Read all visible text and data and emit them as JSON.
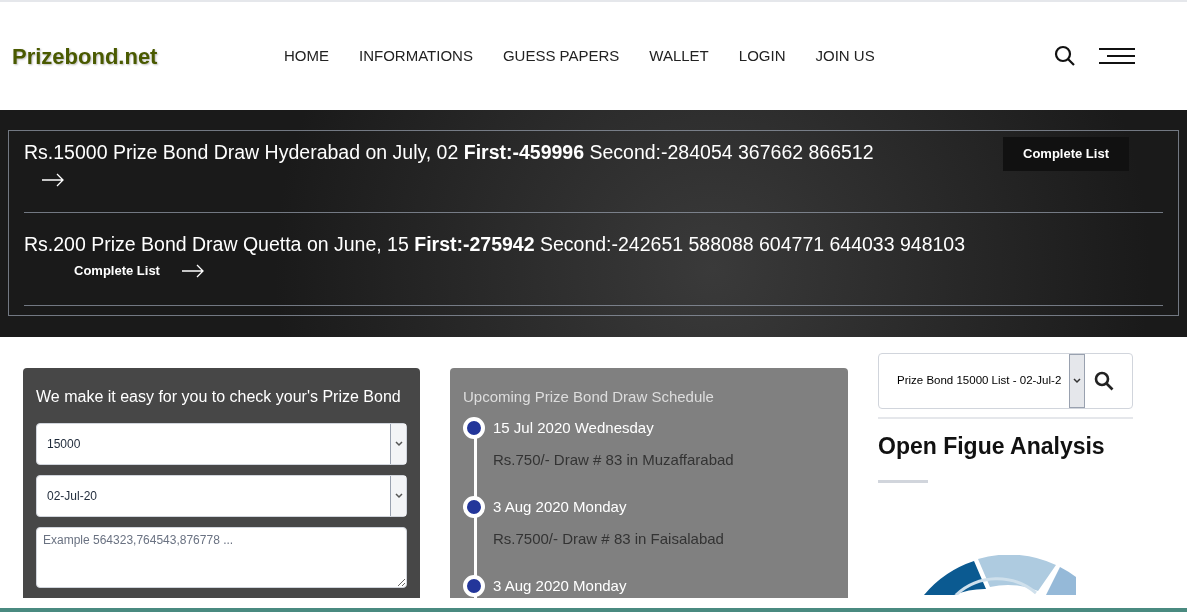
{
  "header": {
    "logo": "Prizebond.net",
    "nav": [
      "HOME",
      "INFORMATIONS",
      "GUESS PAPERS",
      "WALLET",
      "LOGIN",
      "JOIN US"
    ]
  },
  "banner": {
    "draws": [
      {
        "kind": "button_right",
        "text": "Rs.15000 Prize Bond Draw Hyderabad on July, 02 **First:-459996** Second:-284054 367662 866512",
        "button": "Complete List"
      },
      {
        "kind": "button_below",
        "text": "Rs.200 Prize Bond Draw Quetta on June, 15 **First:-275942** Second:-242651 588088 604771 644033 948103",
        "button": "Complete List"
      }
    ]
  },
  "checker": {
    "title": "We make it easy for you to check your's Prize Bond",
    "bond_select": "15000",
    "date_select": "02-Jul-20",
    "numbers_field": {
      "placeholder": "Example 564323,764543,876778 ..."
    }
  },
  "schedule": {
    "title": "Upcoming Prize Bond Draw Schedule",
    "items": [
      {
        "date": "15 Jul 2020 Wednesday",
        "detail": "Rs.750/- Draw # 83 in Muzaffarabad"
      },
      {
        "date": "3 Aug 2020 Monday",
        "detail": "Rs.7500/- Draw # 83 in Faisalabad"
      },
      {
        "date": "3 Aug 2020 Monday"
      }
    ]
  },
  "list_search": {
    "select": "Prize Bond 15000 List - 02-Jul-2"
  },
  "analysis": {
    "title": "Open Figue Analysis"
  }
}
